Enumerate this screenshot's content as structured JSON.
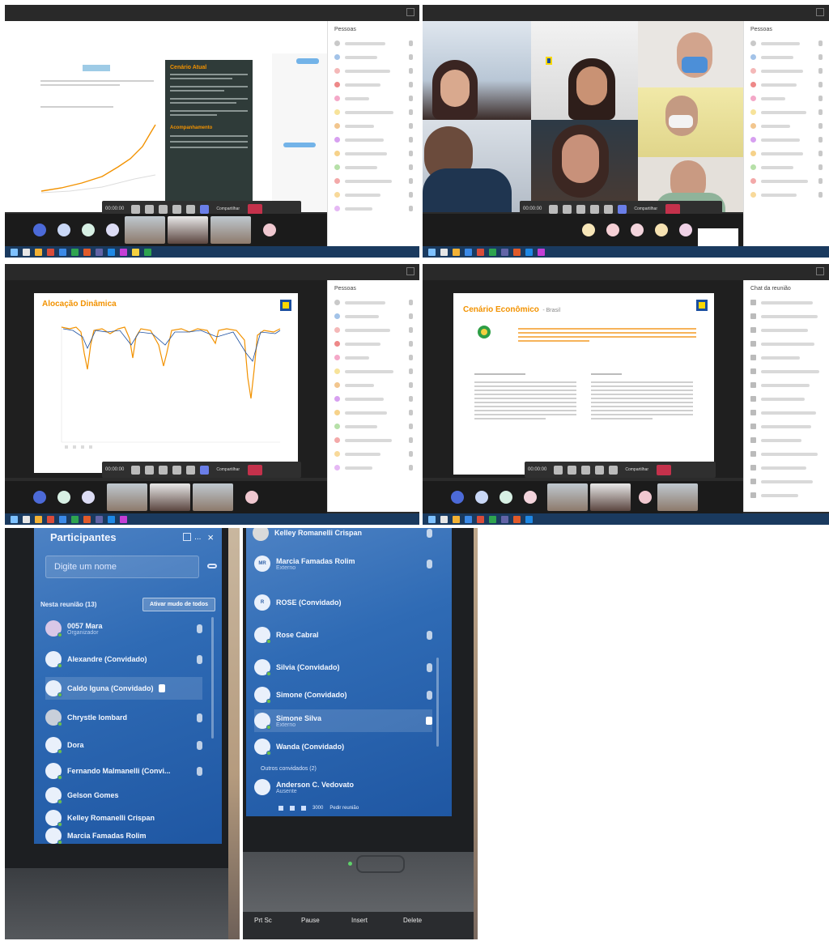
{
  "teams": {
    "participants_panel_title": "Pessoas",
    "meeting_chat_title": "Chat da reunião",
    "time": "00:00:00",
    "share_label": "Compartilhar",
    "participants_count_label": "Participantes"
  },
  "slide_tl": {
    "tag": "",
    "panel_heading": "Cenário Atual",
    "panel_lines": [
      "",
      "",
      "",
      ""
    ],
    "summary_heading": "Acompanhamento",
    "summary_rows": [
      {
        "label": "",
        "value": ""
      },
      {
        "label": "",
        "value": ""
      },
      {
        "label": "",
        "value": ""
      }
    ]
  },
  "slide_bl": {
    "title": "Alocação Dinâmica",
    "subtitle": ""
  },
  "slide_br": {
    "title": "Cenário Econômico",
    "title_suffix": "- Brasil"
  },
  "phone_left": {
    "header": "Participantes",
    "more": "...",
    "close": "×",
    "search_placeholder": "Digite um nome",
    "section_label": "Nesta reunião (13)",
    "mute_all": "Ativar mudo de todos",
    "participants": [
      {
        "name": "0057 Mara",
        "role": "Organizador"
      },
      {
        "name": "Alexandre (Convidado)",
        "role": ""
      },
      {
        "name": "Caldo Iguna (Convidado)",
        "role": ""
      },
      {
        "name": "Chrystle lombard",
        "role": ""
      },
      {
        "name": "Dora",
        "role": ""
      },
      {
        "name": "Fernando Malmanelli (Convi...",
        "role": ""
      },
      {
        "name": "Gelson Gomes",
        "role": ""
      },
      {
        "name": "Kelley Romanelli Crispan",
        "role": ""
      },
      {
        "name": "Marcia Famadas Rolim",
        "role": ""
      }
    ]
  },
  "phone_right": {
    "top_name": "Kelley Romanelli Crispan",
    "participants": [
      {
        "name": "Marcia Famadas Rolim",
        "role": "Externo",
        "initials": "MR"
      },
      {
        "name": "ROSE (Convidado)",
        "role": "",
        "initials": "R"
      },
      {
        "name": "Rose Cabral",
        "role": "",
        "initials": ""
      },
      {
        "name": "Silvia (Convidado)",
        "role": "",
        "initials": ""
      },
      {
        "name": "Simone (Convidado)",
        "role": "",
        "initials": ""
      },
      {
        "name": "Simone Silva",
        "role": "Externo",
        "initials": ""
      },
      {
        "name": "Wanda (Convidado)",
        "role": "",
        "initials": ""
      }
    ],
    "section_label": "Outros convidados (2)",
    "last_name": "Anderson C. Vedovato",
    "last_role": "Ausente",
    "keys": [
      "Prt Sc",
      "Pause",
      "Insert",
      "Delete"
    ],
    "counter": "3000",
    "extra_label": "Pedir reunião"
  },
  "colors": {
    "teams_dark": "#292929",
    "accent_orange": "#f29200",
    "bb_blue": "#1b4fa0",
    "bb_yellow": "#fcd800",
    "leave_red": "#c4314b",
    "phone_blue": "#2f6bb5"
  }
}
